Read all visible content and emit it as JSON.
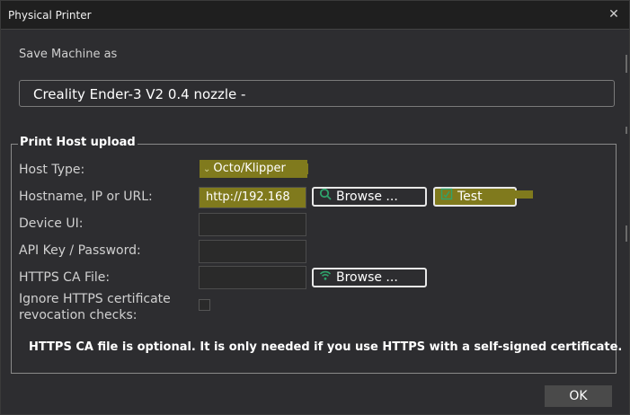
{
  "window": {
    "title": "Physical Printer",
    "close_glyph": "✕"
  },
  "save": {
    "label": "Save Machine as",
    "machine_name": "Creality Ender-3 V2 0.4 nozzle -"
  },
  "print_host": {
    "group_title": "Print Host upload",
    "host_type_label": "Host Type:",
    "host_type_value": "Octo/Klipper",
    "hostname_label": "Hostname, IP or URL:",
    "hostname_value": "http://192.168",
    "browse_label": "Browse ...",
    "test_label": "Test",
    "device_ui_label": "Device UI:",
    "api_key_label": "API Key / Password:",
    "https_ca_label": "HTTPS CA File:",
    "browse2_label": "Browse ...",
    "ignore_label_line1": "Ignore HTTPS certificate",
    "ignore_label_line2": "revocation checks:",
    "note": "HTTPS CA file is optional. It is only needed if you use HTTPS with a self-signed certificate."
  },
  "footer": {
    "ok_label": "OK"
  },
  "colors": {
    "highlight": "#807a1d",
    "accent_icon": "#2ea36b",
    "background": "#2d2d30"
  },
  "icons": {
    "close": "close-icon",
    "dropdown": "chevron-down-icon",
    "browse": "search-icon",
    "test": "test-icon",
    "browse_ca": "wifi-icon"
  }
}
